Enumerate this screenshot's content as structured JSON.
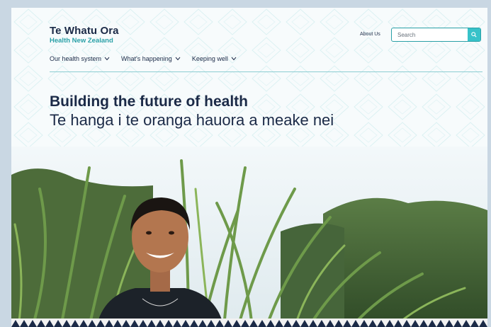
{
  "logo": {
    "title": "Te Whatu Ora",
    "subtitle": "Health New Zealand"
  },
  "header": {
    "about_label": "About Us"
  },
  "search": {
    "placeholder": "Search",
    "value": "",
    "icon": "search-icon"
  },
  "nav": {
    "items": [
      {
        "label": "Our health system",
        "icon": "chevron-down-icon"
      },
      {
        "label": "What's happening",
        "icon": "chevron-down-icon"
      },
      {
        "label": "Keeping well",
        "icon": "chevron-down-icon"
      }
    ]
  },
  "hero": {
    "title": "Building the future of health",
    "subtitle": "Te hanga i te oranga hauora a meake nei"
  },
  "colors": {
    "navy": "#1b2a47",
    "teal": "#2aa0a7",
    "search_button": "#37c2c9"
  }
}
